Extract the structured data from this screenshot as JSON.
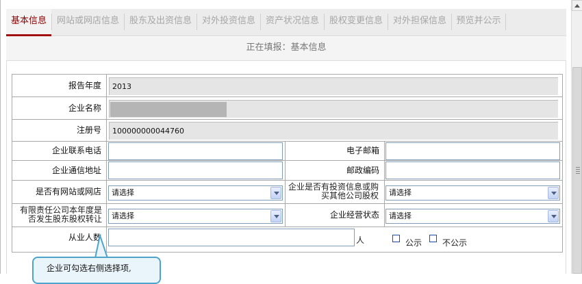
{
  "tabs": [
    {
      "label": "基本信息",
      "active": true
    },
    {
      "label": "网站或网店信息",
      "active": false
    },
    {
      "label": "股东及出资信息",
      "active": false
    },
    {
      "label": "对外投资信息",
      "active": false
    },
    {
      "label": "资产状况信息",
      "active": false
    },
    {
      "label": "股权变更信息",
      "active": false
    },
    {
      "label": "对外担保信息",
      "active": false
    },
    {
      "label": "预览并公示",
      "active": false
    }
  ],
  "status_text": "正在填报：基本信息",
  "form": {
    "report_year": {
      "label": "报告年度",
      "value": "2013"
    },
    "company_name": {
      "label": "企业名称",
      "value": ""
    },
    "reg_no": {
      "label": "注册号",
      "value": "100000000044760"
    },
    "phone": {
      "label": "企业联系电话",
      "value": ""
    },
    "email": {
      "label": "电子邮箱",
      "value": ""
    },
    "address": {
      "label": "企业通信地址",
      "value": ""
    },
    "postcode": {
      "label": "邮政编码",
      "value": ""
    },
    "has_website": {
      "label": "是否有网站或网店",
      "value": "请选择"
    },
    "has_investment": {
      "label_line1": "企业是否有投资信息或购",
      "label_line2": "买其他公司股权",
      "value": "请选择"
    },
    "equity_transfer": {
      "label_line1": "有限责任公司本年度是",
      "label_line2": "否发生股东股权转让",
      "value": "请选择"
    },
    "business_status": {
      "label": "企业经营状态",
      "value": "请选择"
    },
    "employees": {
      "label": "从业人数",
      "value": "",
      "unit": "人",
      "opt_public": "公示",
      "opt_private": "不公示"
    }
  },
  "tooltip": {
    "text": "企业可勾选右侧选择项,"
  },
  "colors": {
    "tab_active": "#8a0000",
    "tab_underline": "#a10c0c",
    "tooltip_border": "#4ca4cc"
  }
}
